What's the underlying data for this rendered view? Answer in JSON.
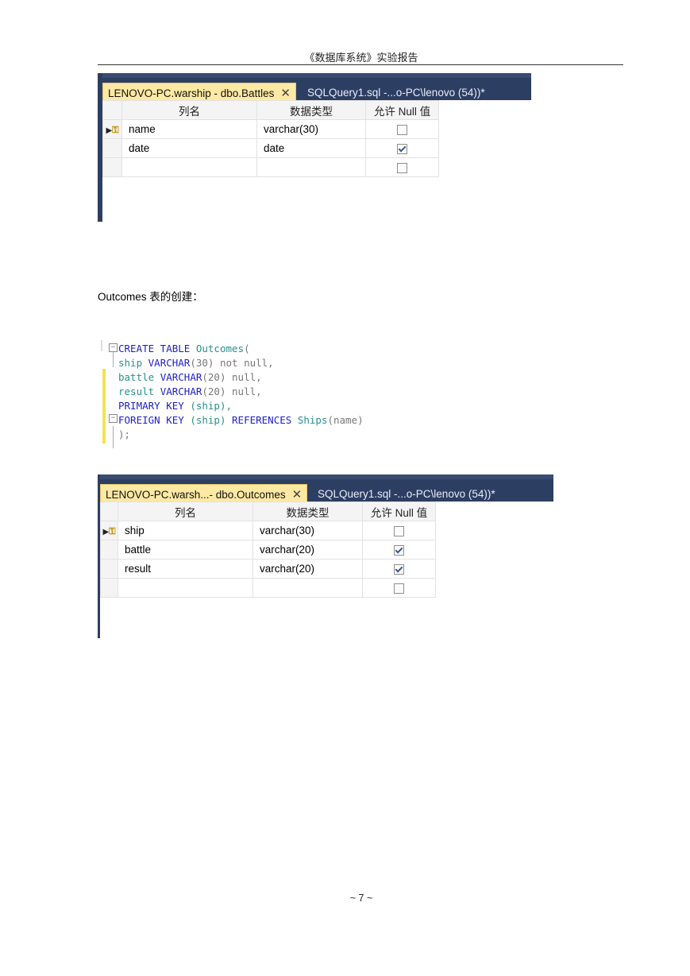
{
  "header": {
    "title": "《数据库系统》实验报告"
  },
  "battles_designer": {
    "tab_active": "LENOVO-PC.warship - dbo.Battles",
    "tab_inactive": "SQLQuery1.sql -...o-PC\\lenovo (54))*",
    "columns": [
      "列名",
      "数据类型",
      "允许 Null 值"
    ],
    "rows": [
      {
        "name": "name",
        "type": "varchar(30)",
        "nullable": false,
        "key": true
      },
      {
        "name": "date",
        "type": "date",
        "nullable": true,
        "key": false
      },
      {
        "name": "",
        "type": "",
        "nullable": false,
        "key": false
      }
    ]
  },
  "outcomes_caption": "Outcomes 表的创建：",
  "sql": {
    "line1_kw": "CREATE TABLE",
    "line1_name": "Outcomes",
    "line1_punct": "(",
    "line2_col": "ship",
    "line2_type": "VARCHAR",
    "line2_len": "(30)",
    "line2_rest": "not null,",
    "line3_col": "battle",
    "line3_type": "VARCHAR",
    "line3_len": "(20)",
    "line3_rest": "null,",
    "line4_col": "result",
    "line4_type": "VARCHAR",
    "line4_len": "(20)",
    "line4_rest": "null,",
    "line5_kw": "PRIMARY KEY",
    "line5_rest": "(ship),",
    "line6_kw": "FOREIGN KEY",
    "line6_arg": "(ship)",
    "line6_kw2": "REFERENCES",
    "line6_ref": "Ships",
    "line6_refarg": "(name)",
    "line7": ");"
  },
  "outcomes_designer": {
    "tab_active": "LENOVO-PC.warsh...- dbo.Outcomes",
    "tab_inactive": "SQLQuery1.sql -...o-PC\\lenovo (54))*",
    "columns": [
      "列名",
      "数据类型",
      "允许 Null 值"
    ],
    "rows": [
      {
        "name": "ship",
        "type": "varchar(30)",
        "nullable": false,
        "key": true
      },
      {
        "name": "battle",
        "type": "varchar(20)",
        "nullable": true,
        "key": false
      },
      {
        "name": "result",
        "type": "varchar(20)",
        "nullable": true,
        "key": false
      },
      {
        "name": "",
        "type": "",
        "nullable": false,
        "key": false
      }
    ]
  },
  "page_number": "~ 7 ~",
  "colors": {
    "tab_bg": "#2d3e63",
    "active_tab": "#fde9a4",
    "keyword": "#1f1fc4",
    "type_name": "#2a8f8f"
  },
  "icons": {
    "row_selector": "arrow-key-icon",
    "close_tab": "close-icon",
    "checkbox": "checkbox-icon"
  }
}
